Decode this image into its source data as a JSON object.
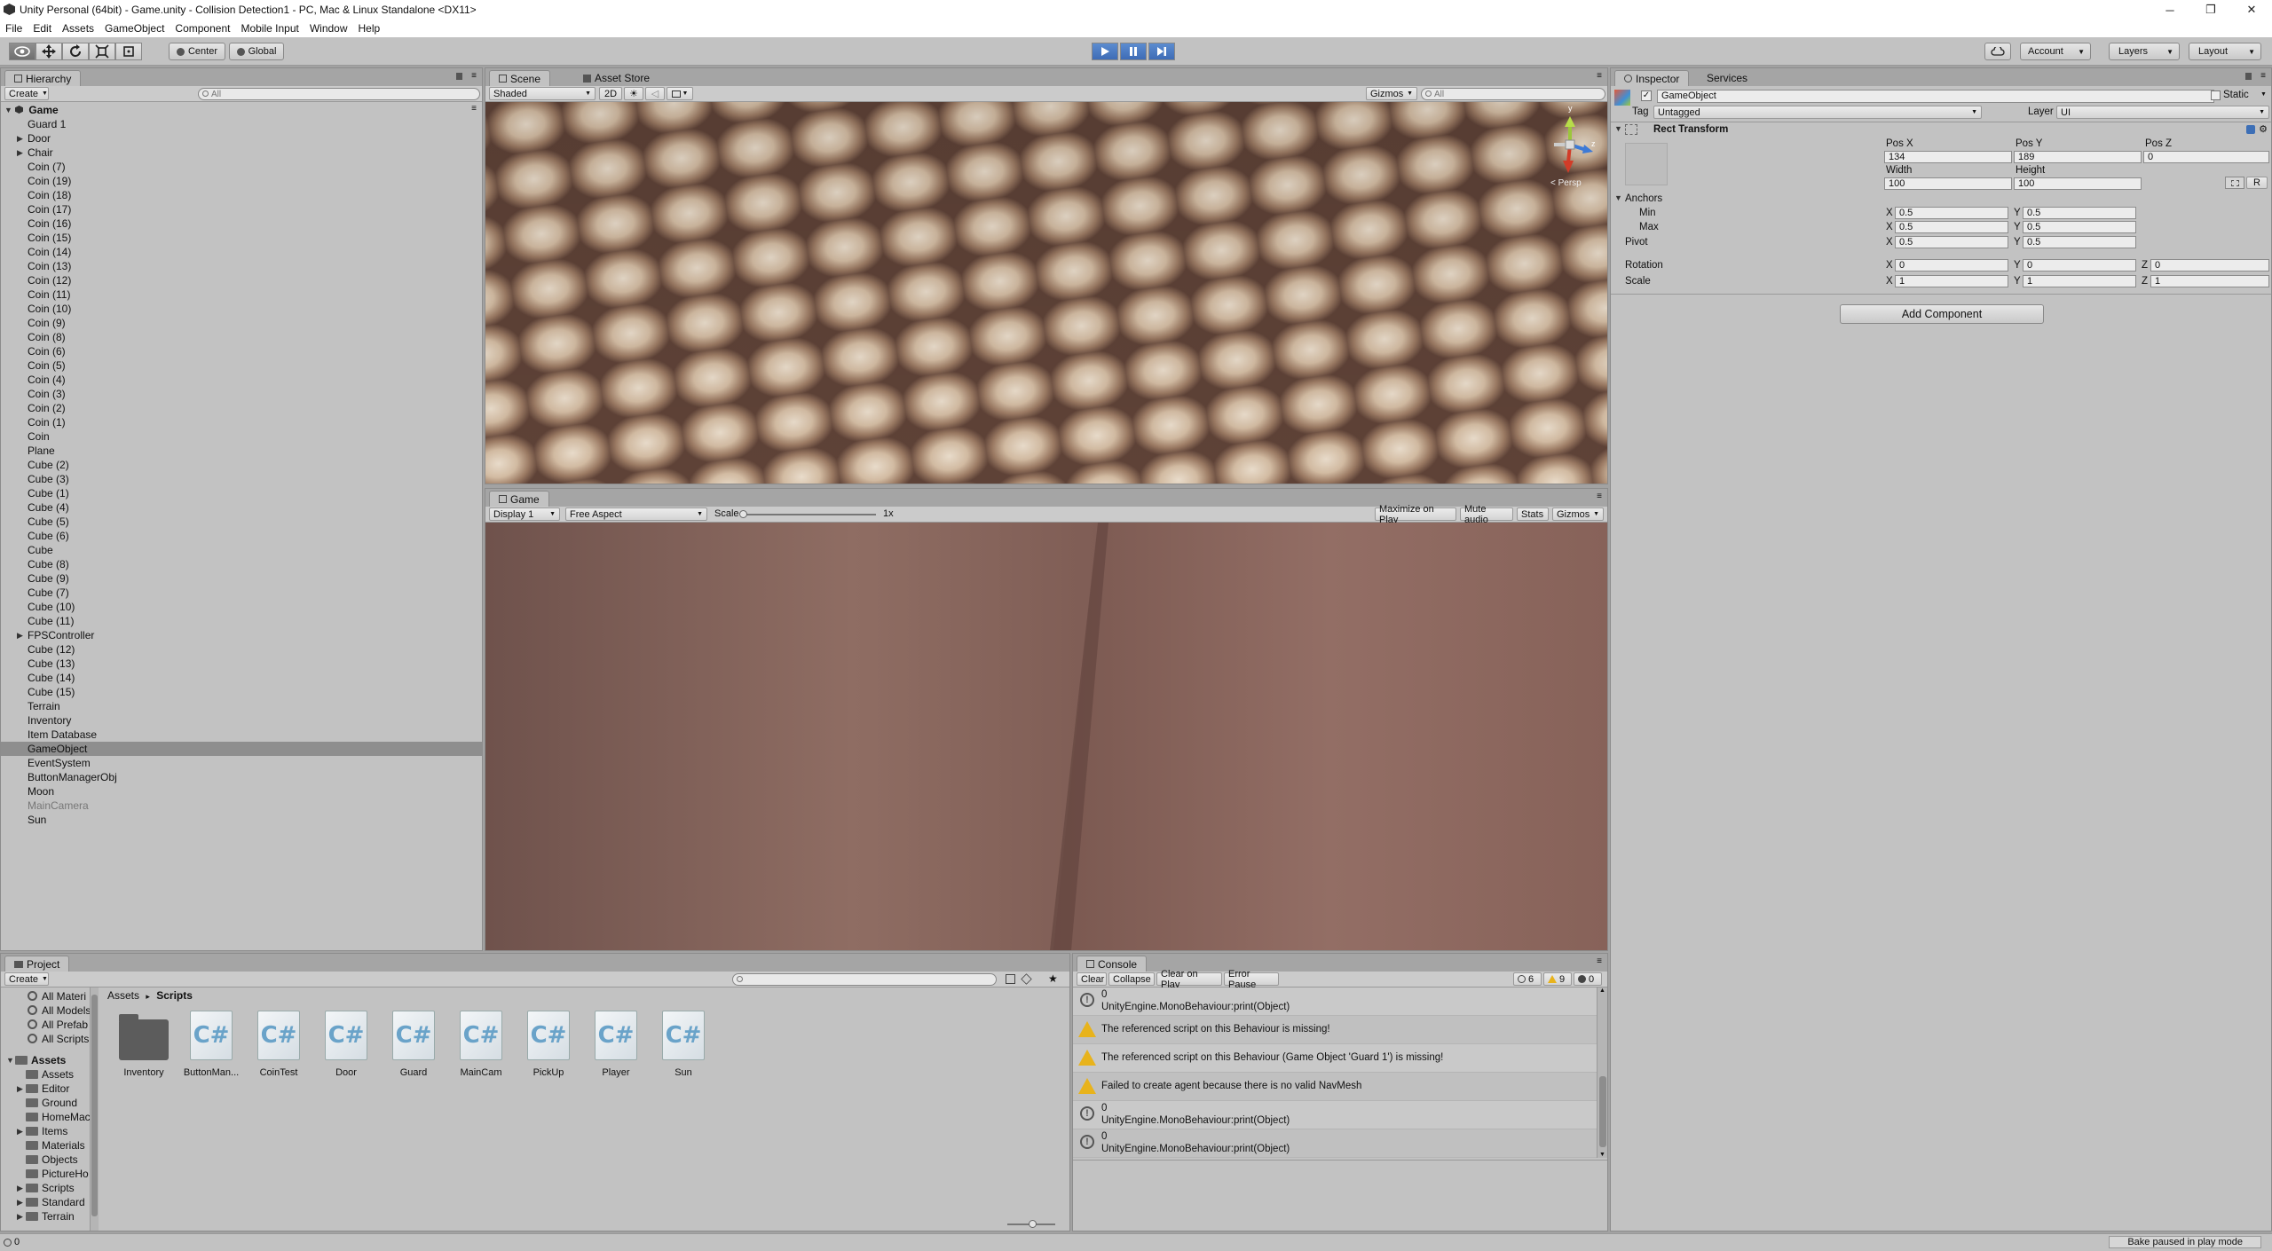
{
  "window": {
    "title": "Unity Personal (64bit) - Game.unity - Collision Detection1 - PC, Mac & Linux Standalone <DX11>",
    "minimize": "─",
    "maximize": "❐",
    "close": "✕"
  },
  "menu": [
    "File",
    "Edit",
    "Assets",
    "GameObject",
    "Component",
    "Mobile Input",
    "Window",
    "Help"
  ],
  "toolbar": {
    "pivot": "Center",
    "space": "Global",
    "account": "Account",
    "layers": "Layers",
    "layout": "Layout"
  },
  "hierarchy": {
    "tab": "Hierarchy",
    "create": "Create",
    "search_placeholder": "All",
    "scene": "Game",
    "items": [
      {
        "label": "Guard 1"
      },
      {
        "label": "Door",
        "expand": true
      },
      {
        "label": "Chair",
        "expand": true
      },
      {
        "label": "Coin (7)"
      },
      {
        "label": "Coin (19)"
      },
      {
        "label": "Coin (18)"
      },
      {
        "label": "Coin (17)"
      },
      {
        "label": "Coin (16)"
      },
      {
        "label": "Coin (15)"
      },
      {
        "label": "Coin (14)"
      },
      {
        "label": "Coin (13)"
      },
      {
        "label": "Coin (12)"
      },
      {
        "label": "Coin (11)"
      },
      {
        "label": "Coin (10)"
      },
      {
        "label": "Coin (9)"
      },
      {
        "label": "Coin (8)"
      },
      {
        "label": "Coin (6)"
      },
      {
        "label": "Coin (5)"
      },
      {
        "label": "Coin (4)"
      },
      {
        "label": "Coin (3)"
      },
      {
        "label": "Coin (2)"
      },
      {
        "label": "Coin (1)"
      },
      {
        "label": "Coin"
      },
      {
        "label": "Plane"
      },
      {
        "label": "Cube (2)"
      },
      {
        "label": "Cube (3)"
      },
      {
        "label": "Cube (1)"
      },
      {
        "label": "Cube (4)"
      },
      {
        "label": "Cube (5)"
      },
      {
        "label": "Cube (6)"
      },
      {
        "label": "Cube"
      },
      {
        "label": "Cube (8)"
      },
      {
        "label": "Cube (9)"
      },
      {
        "label": "Cube (7)"
      },
      {
        "label": "Cube (10)"
      },
      {
        "label": "Cube (11)"
      },
      {
        "label": "FPSController",
        "expand": true
      },
      {
        "label": "Cube (12)"
      },
      {
        "label": "Cube (13)"
      },
      {
        "label": "Cube (14)"
      },
      {
        "label": "Cube (15)"
      },
      {
        "label": "Terrain"
      },
      {
        "label": "Inventory"
      },
      {
        "label": "Item Database"
      },
      {
        "label": "GameObject",
        "selected": true
      },
      {
        "label": "EventSystem"
      },
      {
        "label": "ButtonManagerObj"
      },
      {
        "label": "Moon"
      },
      {
        "label": "MainCamera",
        "grey": true
      },
      {
        "label": "Sun"
      }
    ]
  },
  "scene": {
    "tab": "Scene",
    "tab2": "Asset Store",
    "shading": "Shaded",
    "mode2d": "2D",
    "gizmos": "Gizmos",
    "search_placeholder": "All",
    "persp": "< Persp",
    "gizmo_y": "y",
    "gizmo_z": "z"
  },
  "game": {
    "tab": "Game",
    "display": "Display 1",
    "aspect": "Free Aspect",
    "scale_label": "Scale",
    "scale_value": "1x",
    "scale_level": 0,
    "maximize": "Maximize on Play",
    "mute": "Mute audio",
    "stats": "Stats",
    "gizmos": "Gizmos"
  },
  "inspector": {
    "tab": "Inspector",
    "tab2": "Services",
    "object_name": "GameObject",
    "static_label": "Static",
    "tag_label": "Tag",
    "tag_value": "Untagged",
    "layer_label": "Layer",
    "layer_value": "UI",
    "component": "Rect Transform",
    "pos_x_label": "Pos X",
    "pos_y_label": "Pos Y",
    "pos_z_label": "Pos Z",
    "pos_x": "134",
    "pos_y": "189",
    "pos_z": "0",
    "width_label": "Width",
    "height_label": "Height",
    "width": "100",
    "height": "100",
    "anchors": "Anchors",
    "min": "Min",
    "max": "Max",
    "pivot": "Pivot",
    "x": "X",
    "y": "Y",
    "z": "Z",
    "anchor_min_x": "0.5",
    "anchor_min_y": "0.5",
    "anchor_max_x": "0.5",
    "anchor_max_y": "0.5",
    "pivot_x": "0.5",
    "pivot_y": "0.5",
    "rotation": "Rotation",
    "scale": "Scale",
    "rot_x": "0",
    "rot_y": "0",
    "rot_z": "0",
    "scale_x": "1",
    "scale_y": "1",
    "scale_z": "1",
    "r_button": "R",
    "add_component": "Add Component"
  },
  "project": {
    "tab": "Project",
    "create": "Create",
    "favorites": [
      "All Materi",
      "All Models",
      "All Prefab",
      "All Scripts"
    ],
    "assets_root": "Assets",
    "folders": [
      {
        "label": "Assets"
      },
      {
        "label": "Editor",
        "expand": true
      },
      {
        "label": "Ground"
      },
      {
        "label": "HomeMac"
      },
      {
        "label": "Items",
        "expand": true
      },
      {
        "label": "Materials"
      },
      {
        "label": "Objects"
      },
      {
        "label": "PictureHo"
      },
      {
        "label": "Scripts",
        "expand": true
      },
      {
        "label": "Standard",
        "expand": true
      },
      {
        "label": "Terrain",
        "expand": true
      }
    ],
    "breadcrumb_root": "Assets",
    "breadcrumb_sep": "▸",
    "breadcrumb_current": "Scripts",
    "assets": [
      {
        "label": "Inventory",
        "type": "folder"
      },
      {
        "label": "ButtonMan...",
        "type": "script"
      },
      {
        "label": "CoinTest",
        "type": "script"
      },
      {
        "label": "Door",
        "type": "script"
      },
      {
        "label": "Guard",
        "type": "script"
      },
      {
        "label": "MainCam",
        "type": "script"
      },
      {
        "label": "PickUp",
        "type": "script"
      },
      {
        "label": "Player",
        "type": "script"
      },
      {
        "label": "Sun",
        "type": "script"
      }
    ],
    "script_glyph": "C#"
  },
  "console": {
    "tab": "Console",
    "buttons": [
      "Clear",
      "Collapse",
      "Clear on Play",
      "Error Pause"
    ],
    "count_info": "6",
    "count_warn": "9",
    "count_error": "0",
    "entries": [
      {
        "type": "info",
        "line1": "0",
        "line2": "UnityEngine.MonoBehaviour:print(Object)"
      },
      {
        "type": "warn",
        "line1": "The referenced script on this Behaviour is missing!",
        "line2": ""
      },
      {
        "type": "warn",
        "line1": "The referenced script on this Behaviour (Game Object 'Guard 1') is missing!",
        "line2": ""
      },
      {
        "type": "warn",
        "line1": "Failed to create agent because there is no valid NavMesh",
        "line2": ""
      },
      {
        "type": "info",
        "line1": "0",
        "line2": "UnityEngine.MonoBehaviour:print(Object)"
      },
      {
        "type": "info",
        "line1": "0",
        "line2": "UnityEngine.MonoBehaviour:print(Object)"
      }
    ]
  },
  "status": {
    "left": "0",
    "right": "Bake paused in play mode"
  }
}
